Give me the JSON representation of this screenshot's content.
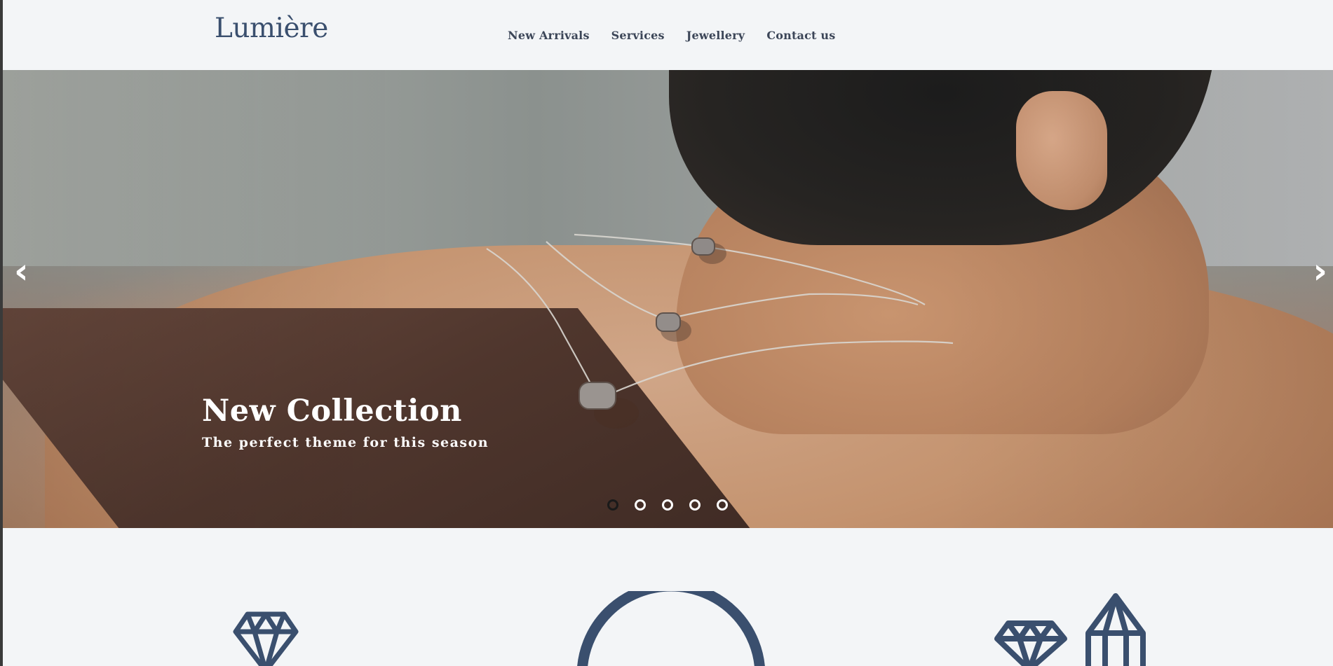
{
  "header": {
    "logo": "Lumière",
    "nav": [
      {
        "label": "New Arrivals"
      },
      {
        "label": "Services"
      },
      {
        "label": "Jewellery"
      },
      {
        "label": "Contact us"
      }
    ]
  },
  "hero": {
    "title": "New Collection",
    "subtitle": "The perfect theme for this season",
    "prev_icon": "‹",
    "next_icon": "›",
    "slide_count": 5,
    "active_slide": 1
  },
  "colors": {
    "accent": "#3a4f6e",
    "background": "#f3f5f7",
    "nav_text": "#3c4658"
  },
  "services": {
    "icons": [
      "diamond-icon",
      "ring-icon",
      "gems-icon"
    ]
  }
}
